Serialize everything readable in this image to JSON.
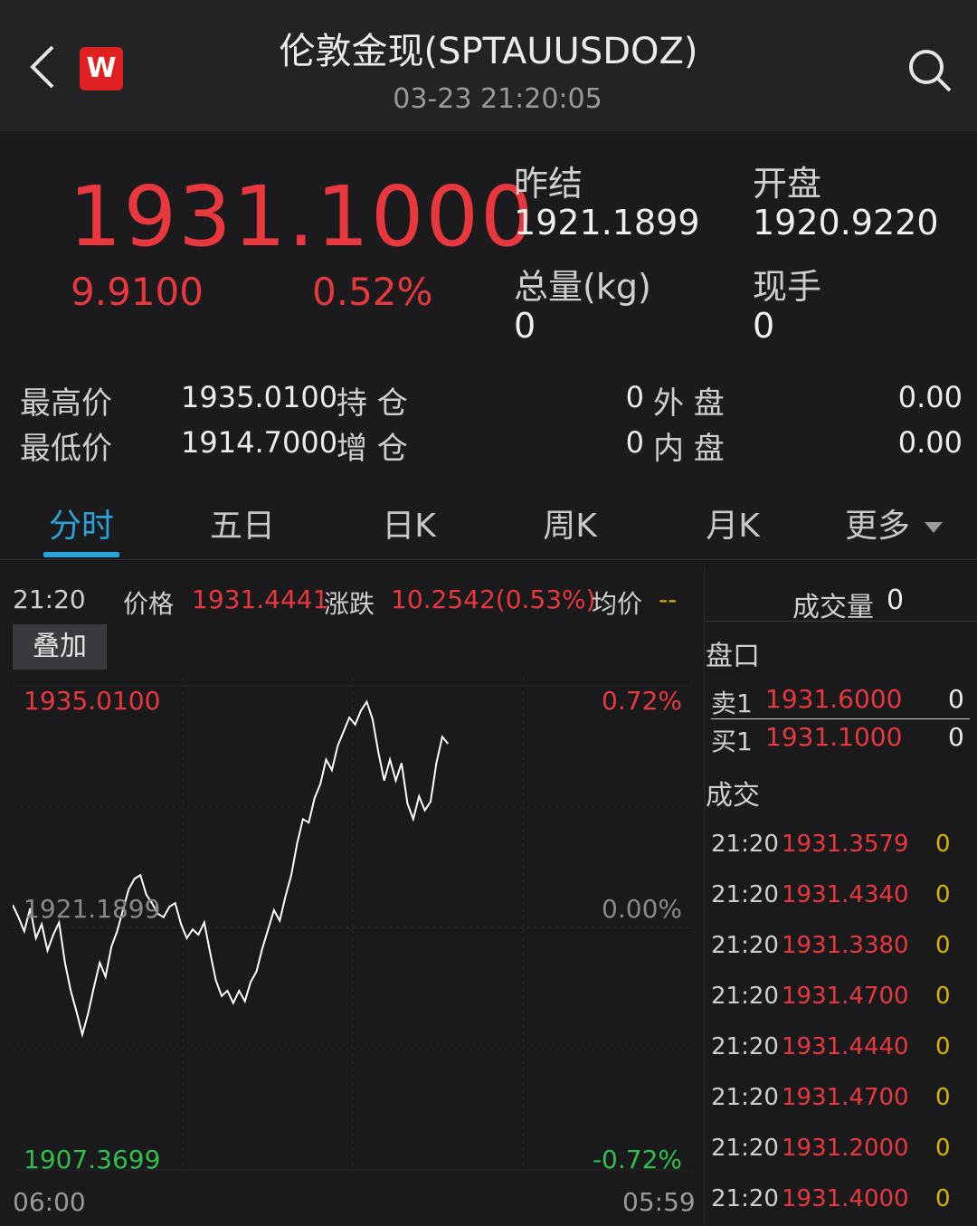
{
  "header": {
    "title": "伦敦金现(SPTAUUSDOZ)",
    "timestamp": "03-23 21:20:05",
    "logo_text": "W",
    "icons": {
      "back": "back-chevron-icon",
      "search": "search-icon"
    }
  },
  "quote": {
    "last_price": "1931.1000",
    "change": "9.9100",
    "change_pct": "0.52%",
    "prev_settle_label": "昨结",
    "prev_settle": "1921.1899",
    "open_label": "开盘",
    "open": "1920.9220",
    "volume_label": "总量(kg)",
    "volume": "0",
    "current_hand_label": "现手",
    "current_hand": "0",
    "high_label": "最高价",
    "high": "1935.0100",
    "low_label": "最低价",
    "low": "1914.7000",
    "open_interest_label": "持 仓",
    "open_interest": "0",
    "oi_change_label": "增 仓",
    "oi_change": "0",
    "outer_label": "外 盘",
    "outer": "0.00",
    "inner_label": "内 盘",
    "inner": "0.00"
  },
  "tabs": [
    "分时",
    "五日",
    "日K",
    "周K",
    "月K",
    "更多"
  ],
  "active_tab": "分时",
  "chart_header": {
    "time": "21:20",
    "price_label": "价格",
    "price": "1931.4441",
    "change_label": "涨跌",
    "change": "10.2542(0.53%)",
    "avg_label": "均价",
    "avg": "--",
    "overlay_button": "叠加"
  },
  "chart_data": {
    "type": "line",
    "y_top": "1935.0100",
    "y_mid": "1921.1899",
    "y_bottom": "1907.3699",
    "pct_top": "0.72%",
    "pct_mid": "0.00%",
    "pct_bottom": "-0.72%",
    "x_start": "06:00",
    "x_end": "05:59",
    "ylim": [
      1907.3699,
      1935.01
    ],
    "series": [
      {
        "values": [
          1922.5,
          1921.8,
          1921.0,
          1922.3,
          1920.6,
          1921.4,
          1919.9,
          1920.8,
          1921.5,
          1919.2,
          1917.6,
          1916.4,
          1915.1,
          1916.3,
          1917.8,
          1919.2,
          1918.4,
          1920.1,
          1921.0,
          1922.2,
          1923.4,
          1924.0,
          1924.2,
          1923.1,
          1922.6,
          1922.0,
          1921.8,
          1922.4,
          1922.6,
          1921.4,
          1920.6,
          1921.1,
          1920.8,
          1921.5,
          1919.8,
          1918.2,
          1917.3,
          1917.6,
          1916.9,
          1917.6,
          1917.0,
          1918.1,
          1918.7,
          1920.0,
          1921.1,
          1922.2,
          1921.6,
          1923.0,
          1924.2,
          1926.0,
          1927.4,
          1927.2,
          1928.6,
          1929.4,
          1930.8,
          1930.2,
          1931.6,
          1932.4,
          1933.2,
          1932.8,
          1933.6,
          1934.1,
          1933.1,
          1931.2,
          1929.6,
          1930.8,
          1929.6,
          1930.6,
          1928.3,
          1927.4,
          1928.7,
          1927.9,
          1928.4,
          1930.6,
          1932.1,
          1931.7
        ]
      }
    ]
  },
  "right_panel": {
    "volume_label": "成交量",
    "volume": "0",
    "orderbook_label": "盘口",
    "ask_label": "卖1",
    "ask_price": "1931.6000",
    "ask_vol": "0",
    "bid_label": "买1",
    "bid_price": "1931.1000",
    "bid_vol": "0",
    "trades_label": "成交",
    "trades": [
      {
        "time": "21:20",
        "price": "1931.3579",
        "vol": "0"
      },
      {
        "time": "21:20",
        "price": "1931.4340",
        "vol": "0"
      },
      {
        "time": "21:20",
        "price": "1931.3380",
        "vol": "0"
      },
      {
        "time": "21:20",
        "price": "1931.4700",
        "vol": "0"
      },
      {
        "time": "21:20",
        "price": "1931.4440",
        "vol": "0"
      },
      {
        "time": "21:20",
        "price": "1931.4700",
        "vol": "0"
      },
      {
        "time": "21:20",
        "price": "1931.2000",
        "vol": "0"
      },
      {
        "time": "21:20",
        "price": "1931.4000",
        "vol": "0"
      }
    ]
  },
  "colors": {
    "up": "#e8383d",
    "down": "#2fbf4a",
    "accent": "#2aa4d8",
    "volume": "#d8b400"
  }
}
